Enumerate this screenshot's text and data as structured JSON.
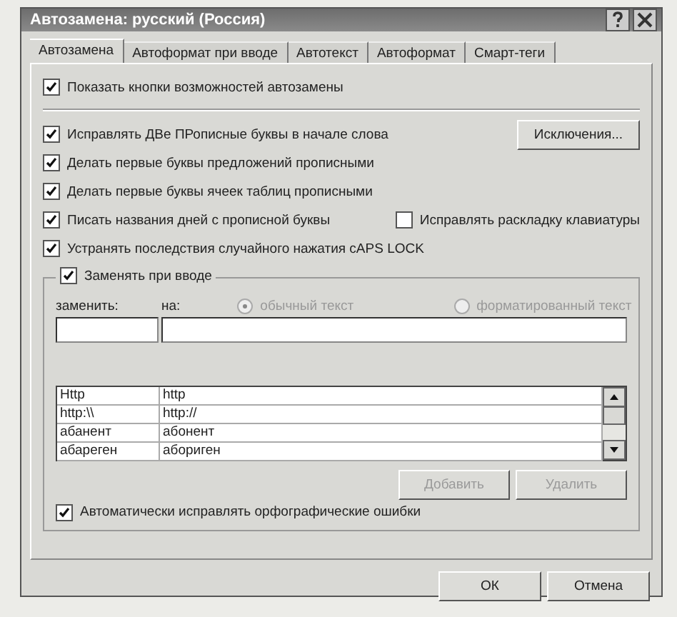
{
  "window": {
    "title": "Автозамена: русский (Россия)"
  },
  "tabs": [
    {
      "label": "Автозамена",
      "selected": true
    },
    {
      "label": "Автоформат при вводе",
      "selected": false
    },
    {
      "label": "Автотекст",
      "selected": false
    },
    {
      "label": "Автоформат",
      "selected": false
    },
    {
      "label": "Смарт-теги",
      "selected": false
    }
  ],
  "show_buttons_checkbox": {
    "label": "Показать кнопки возможностей автозамены",
    "checked": true
  },
  "rules": [
    {
      "label": "Исправлять ДВе ПРописные буквы в начале слова",
      "checked": true,
      "button": "Исключения..."
    },
    {
      "label": "Делать первые буквы предложений прописными",
      "checked": true
    },
    {
      "label": "Делать первые буквы ячеек таблиц прописными",
      "checked": true
    },
    {
      "label": "Писать названия дней с прописной буквы",
      "checked": true,
      "side": {
        "label": "Исправлять раскладку клавиатуры",
        "checked": false
      }
    },
    {
      "label": "Устранять последствия случайного нажатия cAPS LOCK",
      "checked": true
    }
  ],
  "replace_group": {
    "checkbox": {
      "label": "Заменять при вводе",
      "checked": true
    },
    "replace_label": "заменить:",
    "with_label": "на:",
    "format_options": [
      {
        "label": "обычный текст",
        "selected": true,
        "disabled": true
      },
      {
        "label": "форматированный текст",
        "selected": false,
        "disabled": true
      }
    ],
    "entries": [
      {
        "replace": "Http",
        "with": "http"
      },
      {
        "replace": "http:\\\\",
        "with": "http://"
      },
      {
        "replace": "абанент",
        "with": "абонент"
      },
      {
        "replace": "абареген",
        "with": "абориген"
      }
    ],
    "buttons": [
      {
        "label": "Добавить",
        "disabled": true
      },
      {
        "label": "Удалить",
        "disabled": true
      }
    ],
    "spelling_checkbox": {
      "label": "Автоматически исправлять орфографические ошибки",
      "checked": true
    }
  },
  "footer_buttons": [
    {
      "label": "ОК"
    },
    {
      "label": "Отмена"
    }
  ]
}
